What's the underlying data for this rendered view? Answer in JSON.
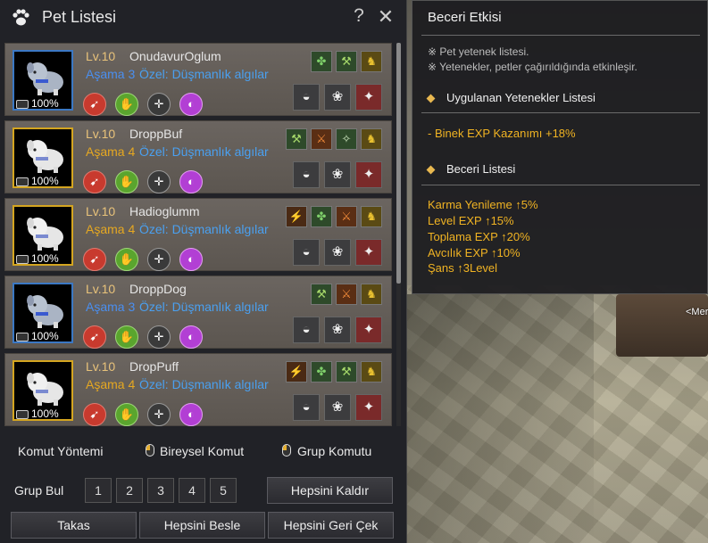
{
  "window": {
    "title": "Pet Listesi",
    "help": "?",
    "close": "✕"
  },
  "pets": [
    {
      "level": "Lv.10",
      "name": "OnudavurOglum",
      "tier": "Aşama 3",
      "tier_color": "blue",
      "special": "Özel: Düşmanlık algılar",
      "feed": "100%",
      "skills": [
        "clover",
        "pick",
        "horse"
      ]
    },
    {
      "level": "Lv.10",
      "name": "DroppBuf",
      "tier": "Aşama 4",
      "tier_color": "gold",
      "special": "Özel: Düşmanlık algılar",
      "feed": "100%",
      "skills": [
        "pick",
        "axe",
        "wing",
        "horse"
      ]
    },
    {
      "level": "Lv.10",
      "name": "Hadioglumm",
      "tier": "Aşama 4",
      "tier_color": "gold",
      "special": "Özel: Düşmanlık algılar",
      "feed": "100%",
      "skills": [
        "sword",
        "clover",
        "axe",
        "horse"
      ]
    },
    {
      "level": "Lv.10",
      "name": "DroppDog",
      "tier": "Aşama 3",
      "tier_color": "blue",
      "special": "Özel: Düşmanlık algılar",
      "feed": "100%",
      "skills": [
        "pick",
        "axe",
        "horse"
      ]
    },
    {
      "level": "Lv.10",
      "name": "DropPuff",
      "tier": "Aşama 4",
      "tier_color": "gold",
      "special": "Özel: Düşmanlık algılar",
      "feed": "100%",
      "skills": [
        "sword",
        "clover",
        "pick",
        "horse"
      ]
    }
  ],
  "command": {
    "label": "Komut Yöntemi",
    "individual": "Bireysel Komut",
    "group": "Grup Komutu"
  },
  "group": {
    "label": "Grup Bul",
    "numbers": [
      "1",
      "2",
      "3",
      "4",
      "5"
    ],
    "remove_all": "Hepsini Kaldır"
  },
  "footer": {
    "trade": "Takas",
    "feed_all": "Hepsini Besle",
    "recall_all": "Hepsini Geri Çek"
  },
  "tooltip": {
    "title": "Beceri Etkisi",
    "note1": "※ Pet yetenek listesi.",
    "note2": "※ Yetenekler, petler çağırıldığında etkinleşir.",
    "applied_head": "Uygulanan Yetenekler Listesi",
    "applied_item": "- Binek EXP Kazanımı +18%",
    "skills_head": "Beceri Listesi",
    "skills": [
      "Karma Yenileme ↑5%",
      "Level EXP ↑15%",
      "Toplama EXP ↑20%",
      "Avcılık EXP ↑10%",
      "Şans ↑3Level"
    ]
  },
  "scene": {
    "npc_label": "<Mer"
  },
  "colors": {
    "tier_blue": "#4a8ff0",
    "tier_gold": "#e6a821",
    "value": "#f0b323"
  }
}
